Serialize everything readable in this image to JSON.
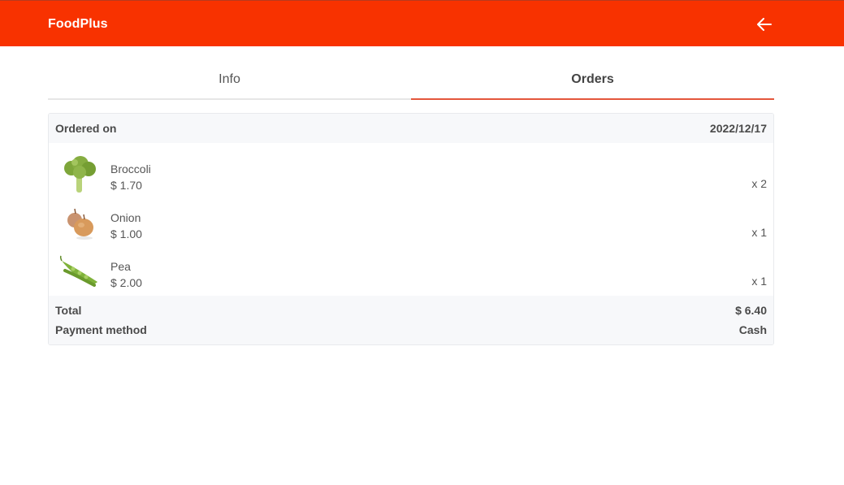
{
  "header": {
    "brand": "FoodPlus",
    "back_icon": "arrow-left-icon",
    "background": "#f83200"
  },
  "tabs": [
    {
      "label": "Info",
      "active": false
    },
    {
      "label": "Orders",
      "active": true
    }
  ],
  "order": {
    "ordered_on_label": "Ordered on",
    "ordered_on_value": "2022/12/17",
    "items": [
      {
        "name": "Broccoli",
        "price": "$ 1.70",
        "qty": "x 2",
        "icon": "broccoli-image"
      },
      {
        "name": "Onion",
        "price": "$ 1.00",
        "qty": "x 1",
        "icon": "onion-image"
      },
      {
        "name": "Pea",
        "price": "$ 2.00",
        "qty": "x 1",
        "icon": "pea-pod-image"
      }
    ],
    "total_label": "Total",
    "total_value": "$ 6.40",
    "payment_label": "Payment method",
    "payment_value": "Cash"
  },
  "colors": {
    "accent": "#e4573c",
    "panel": "#f7f8fa"
  }
}
